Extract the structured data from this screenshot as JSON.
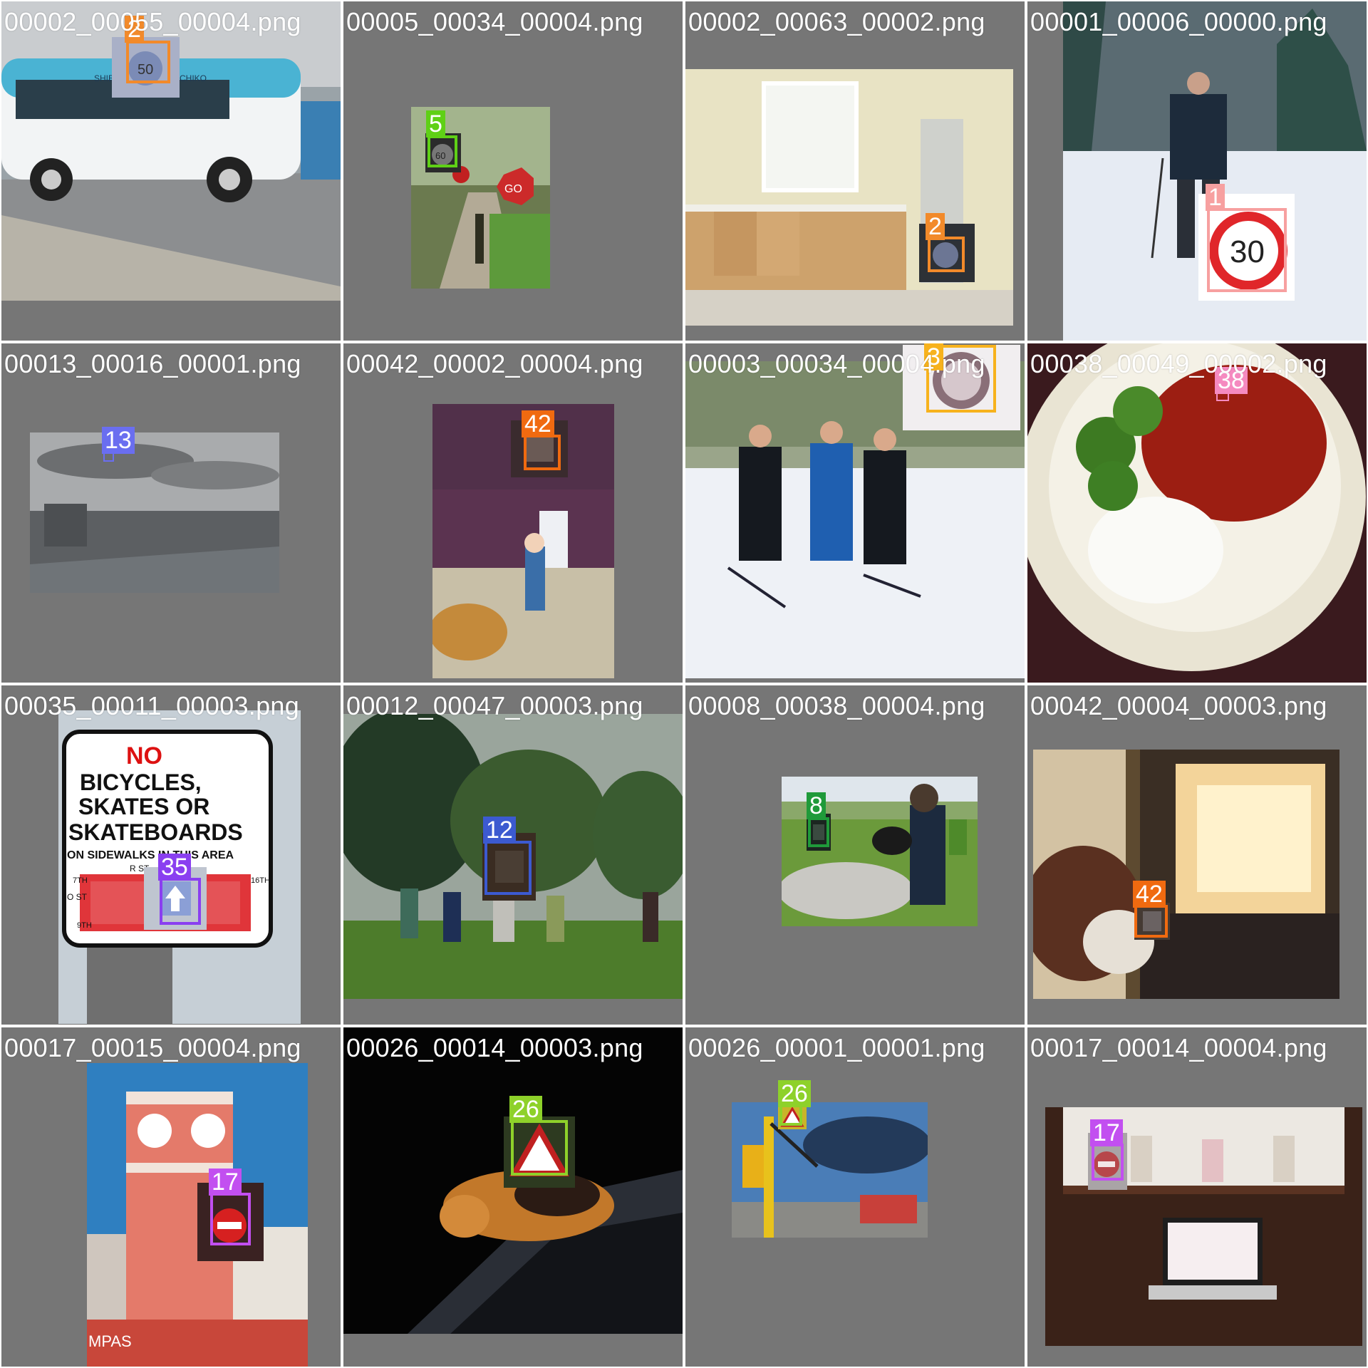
{
  "tiles": [
    {
      "filename": "00002_00055_00004.png",
      "label": "2",
      "color": "#f28a2a"
    },
    {
      "filename": "00005_00034_00004.png",
      "label": "5",
      "color": "#5fd016"
    },
    {
      "filename": "00002_00063_00002.png",
      "label": "2",
      "color": "#f28a2a"
    },
    {
      "filename": "00001_00006_00000.png",
      "label": "1",
      "color": "#f7a0a0"
    },
    {
      "filename": "00013_00016_00001.png",
      "label": "13",
      "color": "#6a6ef0"
    },
    {
      "filename": "00042_00002_00004.png",
      "label": "42",
      "color": "#f06a10"
    },
    {
      "filename": "00003_00034_00004.png",
      "label": "3",
      "color": "#f7b21d"
    },
    {
      "filename": "00038_00049_00002.png",
      "label": "38",
      "color": "#f58ac0"
    },
    {
      "filename": "00035_00011_00003.png",
      "label": "35",
      "color": "#8a3ff0"
    },
    {
      "filename": "00012_00047_00003.png",
      "label": "12",
      "color": "#3c5ad0"
    },
    {
      "filename": "00008_00038_00004.png",
      "label": "8",
      "color": "#1f9a3a"
    },
    {
      "filename": "00042_00004_00003.png",
      "label": "42",
      "color": "#f06a10"
    },
    {
      "filename": "00017_00015_00004.png",
      "label": "17",
      "color": "#c24ff0"
    },
    {
      "filename": "00026_00014_00003.png",
      "label": "26",
      "color": "#8ed12a"
    },
    {
      "filename": "00026_00001_00001.png",
      "label": "26",
      "color": "#8ed12a"
    },
    {
      "filename": "00017_00014_00004.png",
      "label": "17",
      "color": "#c24ff0"
    }
  ],
  "scene_text": {
    "sign_no": "NO",
    "sign_line1": "BICYCLES,",
    "sign_line2": "SKATES OR",
    "sign_line3": "SKATEBOARDS",
    "sign_line4": "ON SIDEWALKS IN THIS AREA",
    "sign_street": "R ST",
    "sign_street_left": "O ST",
    "sign_street_7th": "7TH",
    "sign_street_9th": "9TH",
    "sign_street_16th": "16TH",
    "speed_30": "30",
    "speed_50": "50",
    "speed_60": "60",
    "go_sign": "GO",
    "bus_text": "SHIBU",
    "bus_text2": "CHIKO",
    "building_text": "MPAS"
  },
  "colors": {
    "tile_bg": "#767676",
    "text": "#ffffff"
  }
}
